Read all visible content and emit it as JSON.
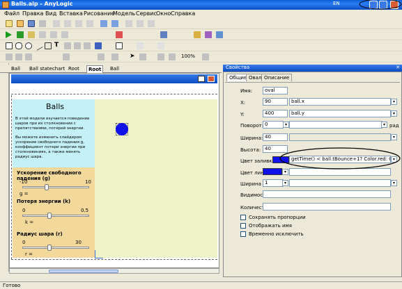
{
  "window": {
    "title": "Balls.alp - AnyLogic",
    "lang": "EN"
  },
  "menu": [
    "Файл",
    "Правка",
    "Вид",
    "Вставка",
    "Рисование",
    "Модель",
    "Сервис",
    "Окно",
    "Справка"
  ],
  "toolbar": {
    "zoom": "100%"
  },
  "tabs": [
    "Ball",
    "Ball statechart",
    "Root",
    "Root",
    "Ball"
  ],
  "model": {
    "title": "Balls",
    "description1": "В этой модели изучается поведение шаров при их столкновении с препятствиями, потерей энергии.",
    "description2": "Вы можете изменить слайдером ускорение свободного падения g, коэффициент потери энергии при столкновениях, а также менять радиус шара.",
    "gravity": {
      "label": "Ускорение свободного падения (g)",
      "min": "-10",
      "max": "10",
      "var": "g ="
    },
    "loss": {
      "label": "Потеря энергии (k)",
      "min": "0",
      "max": "0.5",
      "var": "k ="
    },
    "radius": {
      "label": "Радиус шара (r)",
      "min": "0",
      "max": "30",
      "var": "r ="
    }
  },
  "props": {
    "header": "Свойства",
    "tabs": [
      "Общие",
      "Овал",
      "Описание"
    ],
    "name_label": "Имя:",
    "name_value": "oval",
    "x_label": "X:",
    "x_value": "90",
    "x_expr": "ball.x",
    "y_label": "Y:",
    "y_value": "400",
    "y_expr": "ball.y",
    "rotation_label": "Поворот:",
    "rotation_value": "0",
    "rotation_unit": "рад",
    "width_label": "Ширина:",
    "width_value": "40",
    "height_label": "Высота:",
    "height_value": "40",
    "fill_label": "Цвет заливки:",
    "fill_expr": "getTime() < ball.tBounce+1? Color.red: Color.bl",
    "line_label": "Цвет линии:",
    "line_width_label": "Ширина линии:",
    "line_width_value": "1",
    "visibility_label": "Видимость:",
    "count_label": "Количество:",
    "chk1": "Сохранять пропорции",
    "chk2": "Отображать имя",
    "chk3": "Временно исключить"
  },
  "status": "Готово",
  "colors": {
    "ball": "#1010e8",
    "fill_swatch": "#1010e8"
  }
}
